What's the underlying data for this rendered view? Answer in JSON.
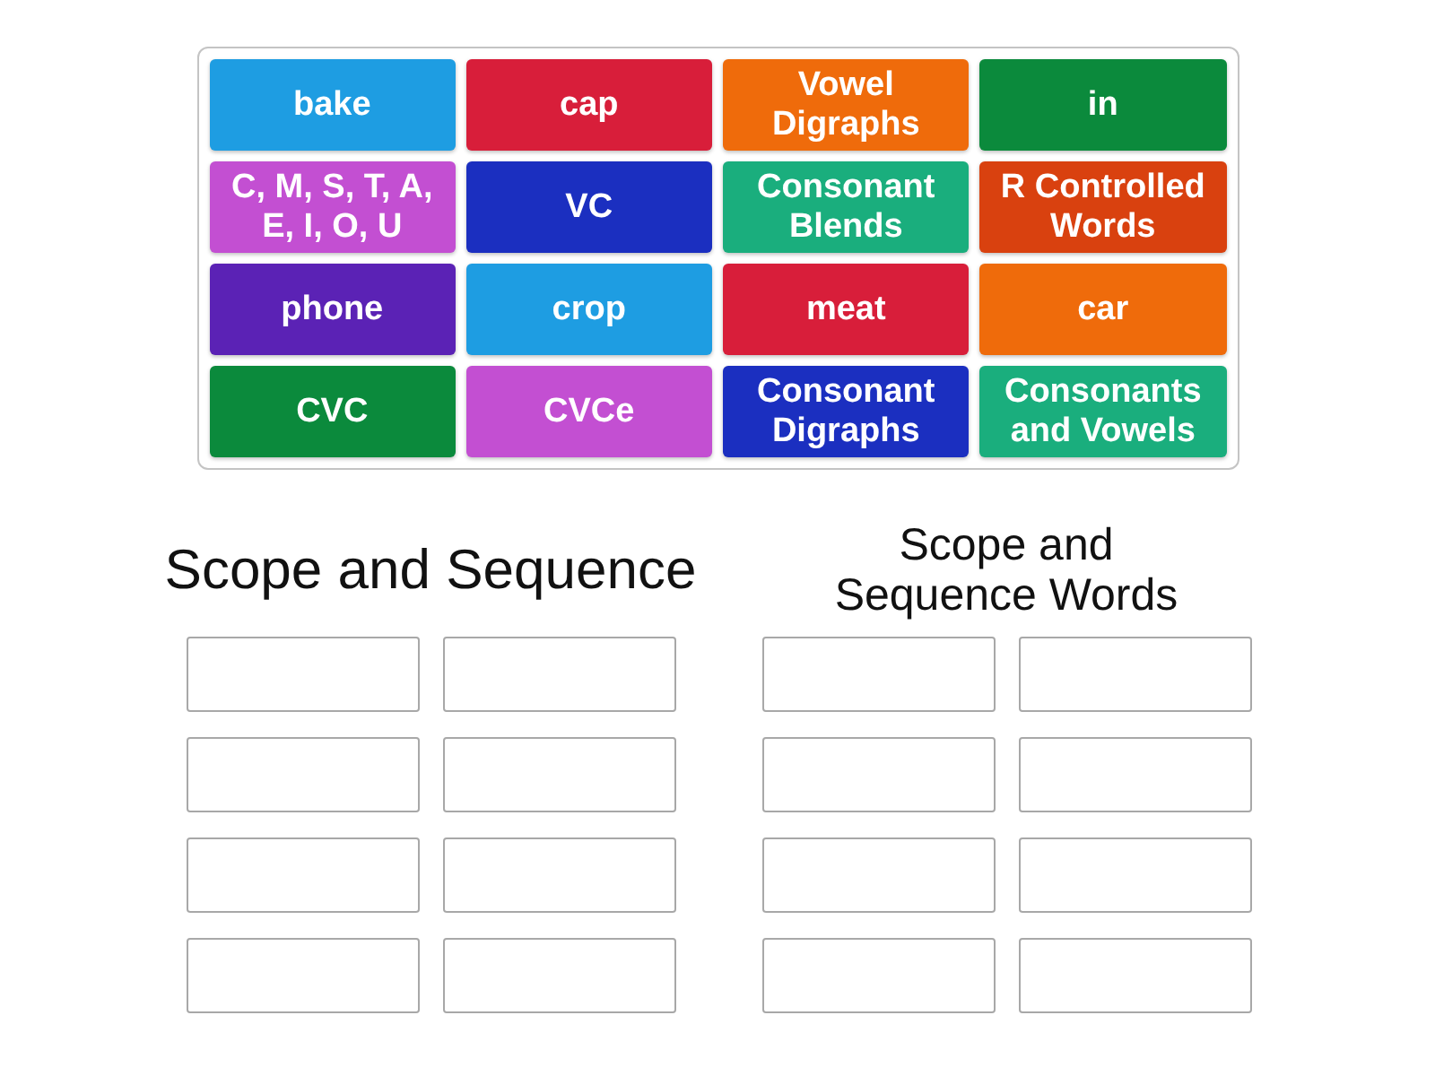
{
  "tiles": [
    {
      "label": "bake",
      "color": "#1e9de2"
    },
    {
      "label": "cap",
      "color": "#d81e3a"
    },
    {
      "label": "Vowel Digraphs",
      "color": "#ef6b0b"
    },
    {
      "label": "in",
      "color": "#0b8a3c"
    },
    {
      "label": "C, M, S, T, A, E, I, O, U",
      "color": "#c34fd2"
    },
    {
      "label": "VC",
      "color": "#1b2fc0"
    },
    {
      "label": "Consonant Blends",
      "color": "#1aae7d"
    },
    {
      "label": "R Controlled Words",
      "color": "#d9410f"
    },
    {
      "label": "phone",
      "color": "#5b22b5"
    },
    {
      "label": "crop",
      "color": "#1e9de2"
    },
    {
      "label": "meat",
      "color": "#d81e3a"
    },
    {
      "label": "car",
      "color": "#ef6b0b"
    },
    {
      "label": "CVC",
      "color": "#0b8a3c"
    },
    {
      "label": "CVCe",
      "color": "#c34fd2"
    },
    {
      "label": "Consonant Digraphs",
      "color": "#1b2fc0"
    },
    {
      "label": "Consonants and Vowels",
      "color": "#1aae7d"
    }
  ],
  "groups": [
    {
      "title": "Scope and Sequence"
    },
    {
      "title": "Scope and Sequence Words"
    }
  ]
}
